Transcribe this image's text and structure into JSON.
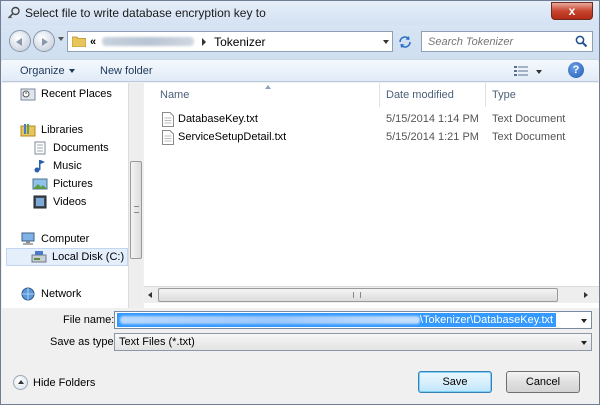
{
  "window": {
    "title": "Select file to write database encryption key to",
    "close_label": "x"
  },
  "address": {
    "prefix": "«",
    "current": "Tokenizer"
  },
  "search": {
    "placeholder": "Search Tokenizer"
  },
  "toolbar": {
    "organize_label": "Organize",
    "new_folder_label": "New folder",
    "help_label": "?"
  },
  "sidebar": {
    "items": [
      {
        "label": "Recent Places",
        "icon": "recent-places-icon"
      },
      {
        "label": "Libraries",
        "icon": "libraries-icon"
      },
      {
        "label": "Documents",
        "icon": "documents-icon"
      },
      {
        "label": "Music",
        "icon": "music-icon"
      },
      {
        "label": "Pictures",
        "icon": "pictures-icon"
      },
      {
        "label": "Videos",
        "icon": "videos-icon"
      },
      {
        "label": "Computer",
        "icon": "computer-icon"
      },
      {
        "label": "Local Disk (C:)",
        "icon": "local-disk-icon",
        "selected": true
      },
      {
        "label": "Network",
        "icon": "network-icon"
      }
    ]
  },
  "filelist": {
    "columns": [
      "Name",
      "Date modified",
      "Type"
    ],
    "rows": [
      {
        "name": "DatabaseKey.txt",
        "date": "5/15/2014 1:14 PM",
        "type": "Text Document"
      },
      {
        "name": "ServiceSetupDetail.txt",
        "date": "5/15/2014 1:21 PM",
        "type": "Text Document"
      }
    ]
  },
  "form": {
    "file_name_label": "File name:",
    "file_name_value_tail": "\\Tokenizer\\DatabaseKey.txt",
    "save_as_type_label": "Save as type:",
    "save_as_type_value": "Text Files (*.txt)"
  },
  "footer": {
    "hide_folders_label": "Hide Folders",
    "save_label": "Save",
    "cancel_label": "Cancel"
  },
  "colors": {
    "accent": "#3399ff",
    "toolbar_text": "#1e395b",
    "close": "#c7452f"
  }
}
